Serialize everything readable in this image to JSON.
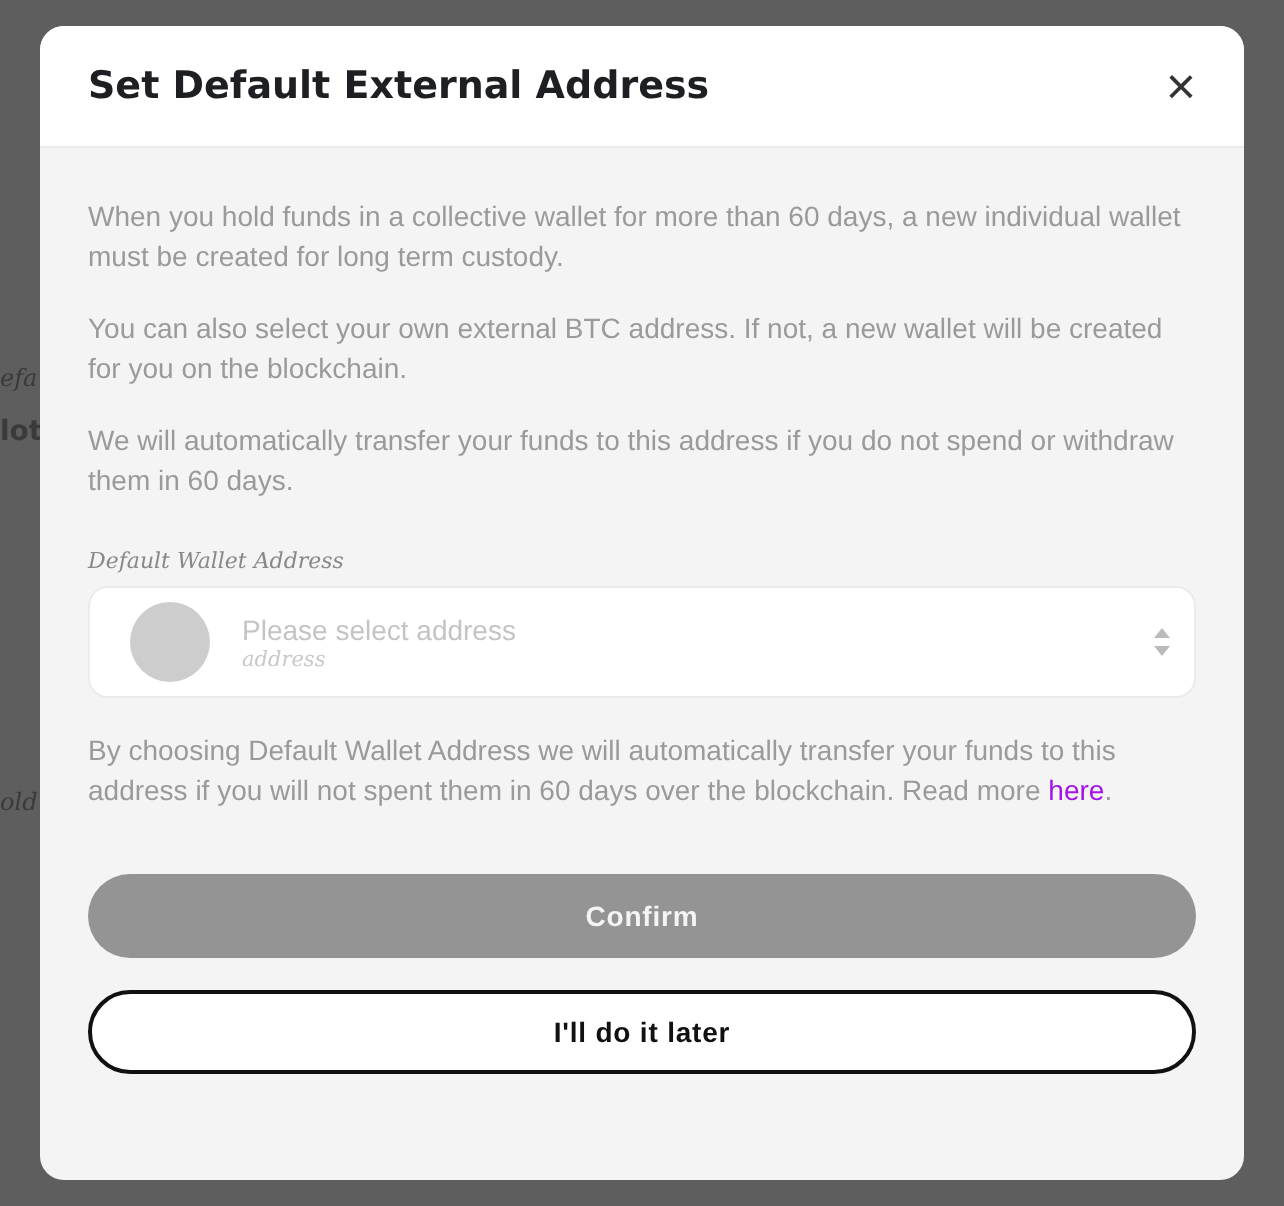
{
  "background": {
    "fragments": [
      {
        "text": "efa",
        "kind": "italic"
      },
      {
        "text": "lot",
        "kind": "bold"
      },
      {
        "text": "old",
        "kind": "italic"
      }
    ]
  },
  "dialog": {
    "title": "Set Default External Address",
    "close": "×",
    "paragraphs": [
      "When you hold funds in a collective wallet for more than 60 days, a new individual wallet must be created for long term custody.",
      "You can also select your own external BTC address. If not, a new wallet will be created for you on the blockchain.",
      "We will automatically transfer your funds to this address if you do not spend or withdraw them in 60 days."
    ],
    "address_field": {
      "label": "Default Wallet Address",
      "placeholder": "Please select address",
      "sublabel": "address"
    },
    "note": "By choosing Default Wallet Address we will automatically transfer your funds to this address if you will not spent them in 60 days over the blockchain. Read more",
    "note_link": "here",
    "note_end": ".",
    "buttons": [
      {
        "label": "Confirm",
        "kind": "primary",
        "disabled": true
      },
      {
        "label": "I'll do it later",
        "kind": "outline",
        "disabled": false
      }
    ]
  }
}
